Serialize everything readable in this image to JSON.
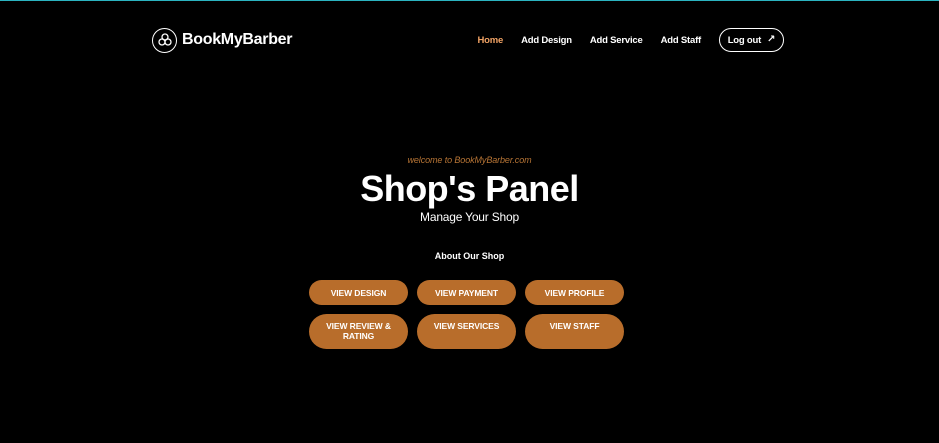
{
  "header": {
    "brand_name": "BookMyBarber",
    "logo_icon": "barber-shop-logo-icon",
    "nav": {
      "home": "Home",
      "add_design": "Add Design",
      "add_service": "Add Service",
      "add_staff": "Add Staff"
    },
    "logout": {
      "label": "Log out",
      "icon": "↗"
    },
    "active_color": "#f0a264"
  },
  "hero": {
    "welcome": "welcome to BookMyBarber.com",
    "title": "Shop's Panel",
    "subtitle": "Manage Your Shop"
  },
  "about": {
    "label": "About Our Shop"
  },
  "actions": {
    "view_design": "VIEW DESIGN",
    "view_payment": "VIEW PAYMENT",
    "view_profile": "VIEW PROFILE",
    "view_review_rating": "VIEW REVIEW & RATING",
    "view_services": "VIEW SERVICES",
    "view_staff": "VIEW STAFF"
  },
  "colors": {
    "background": "#000000",
    "accent_button": "#b86d2b",
    "welcome_text": "#b87535",
    "top_border": "#2bb3c0"
  }
}
